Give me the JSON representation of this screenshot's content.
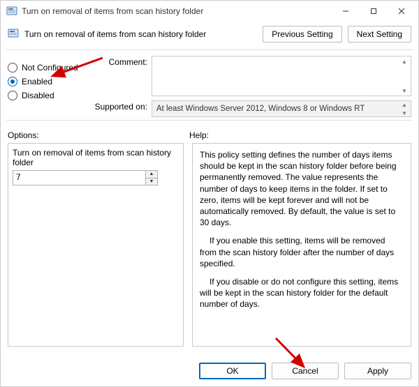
{
  "window": {
    "title": "Turn on removal of items from scan history folder"
  },
  "header": {
    "title": "Turn on removal of items from scan history folder",
    "prev": "Previous Setting",
    "next": "Next Setting"
  },
  "state": {
    "not_configured": "Not Configured",
    "enabled": "Enabled",
    "disabled": "Disabled",
    "selected": "enabled"
  },
  "comment": {
    "label": "Comment:",
    "value": ""
  },
  "supported": {
    "label": "Supported on:",
    "value": "At least Windows Server 2012, Windows 8 or Windows RT"
  },
  "labels": {
    "options": "Options:",
    "help": "Help:"
  },
  "options": {
    "text": "Turn on removal of items from scan history folder",
    "value": "7"
  },
  "help": {
    "p1": "This policy setting defines the number of days items should be kept in the scan history folder before being permanently removed. The value represents the number of days to keep items in the folder. If set to zero, items will be kept forever and will not be automatically removed. By default, the value is set to 30 days.",
    "p2": "If you enable this setting, items will be removed from the scan history folder after the number of days specified.",
    "p3": "If you disable or do not configure this setting, items will be kept in the scan history folder for the default number of days."
  },
  "footer": {
    "ok": "OK",
    "cancel": "Cancel",
    "apply": "Apply"
  },
  "colors": {
    "annotation": "#d40000",
    "accent": "#0067c0"
  }
}
